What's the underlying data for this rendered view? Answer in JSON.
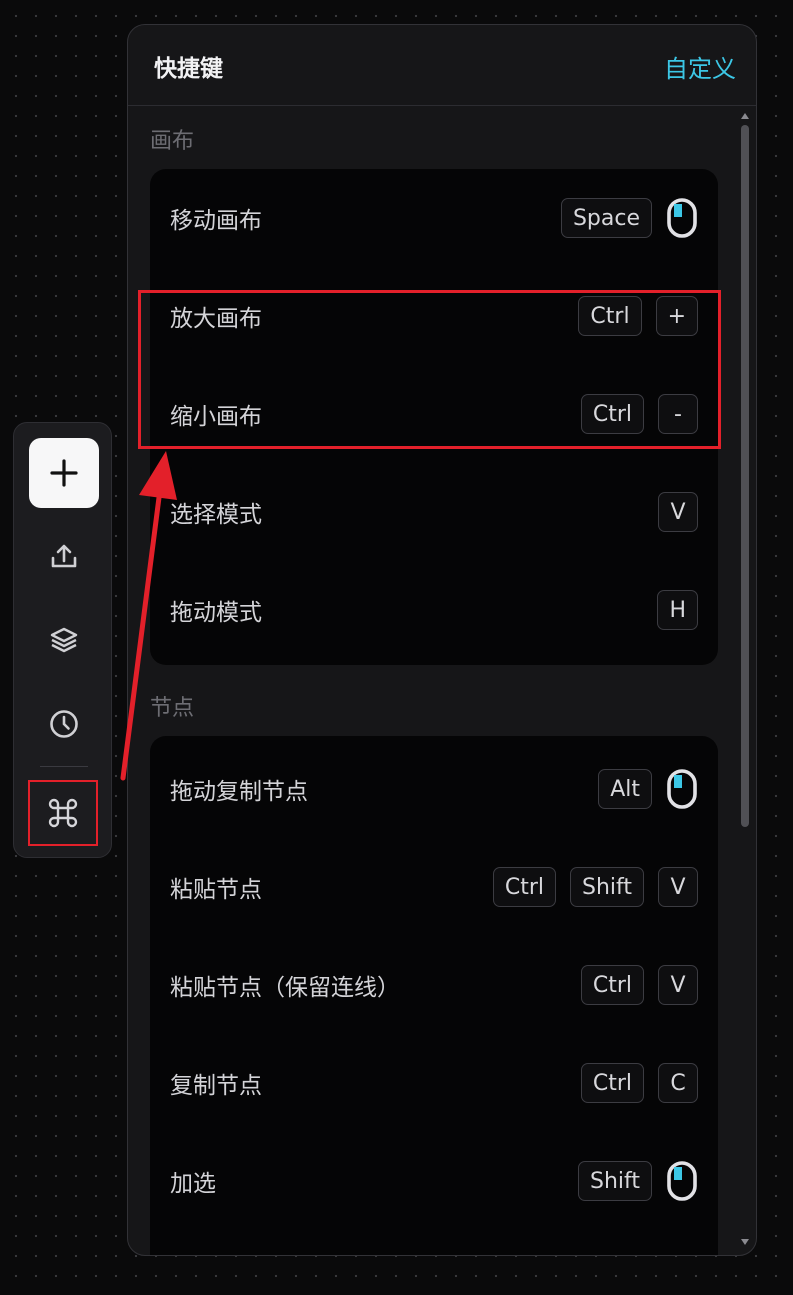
{
  "colors": {
    "accent": "#3cc7e6",
    "highlight": "#e3202a",
    "panel_bg": "#161618",
    "card_bg": "#050506"
  },
  "toolbar": {
    "items": [
      {
        "name": "add-button",
        "icon": "plus-icon"
      },
      {
        "name": "export-button",
        "icon": "upload-icon"
      },
      {
        "name": "layers-button",
        "icon": "layers-icon"
      },
      {
        "name": "history-button",
        "icon": "clock-icon"
      },
      {
        "name": "shortcuts-button",
        "icon": "command-icon"
      }
    ]
  },
  "panel": {
    "title": "快捷键",
    "customize": "自定义"
  },
  "sections": [
    {
      "label": "画布",
      "rows": [
        {
          "label": "移动画布",
          "keys": [
            "Space"
          ],
          "mouse": true
        },
        {
          "label": "放大画布",
          "keys": [
            "Ctrl",
            "+"
          ],
          "mouse": false
        },
        {
          "label": "缩小画布",
          "keys": [
            "Ctrl",
            "-"
          ],
          "mouse": false
        },
        {
          "label": "选择模式",
          "keys": [
            "V"
          ],
          "mouse": false
        },
        {
          "label": "拖动模式",
          "keys": [
            "H"
          ],
          "mouse": false
        }
      ]
    },
    {
      "label": "节点",
      "rows": [
        {
          "label": "拖动复制节点",
          "keys": [
            "Alt"
          ],
          "mouse": true
        },
        {
          "label": "粘贴节点",
          "keys": [
            "Ctrl",
            "Shift",
            "V"
          ],
          "mouse": false
        },
        {
          "label": "粘贴节点（保留连线）",
          "keys": [
            "Ctrl",
            "V"
          ],
          "mouse": false
        },
        {
          "label": "复制节点",
          "keys": [
            "Ctrl",
            "C"
          ],
          "mouse": false
        },
        {
          "label": "加选",
          "keys": [
            "Shift"
          ],
          "mouse": true
        }
      ]
    }
  ]
}
